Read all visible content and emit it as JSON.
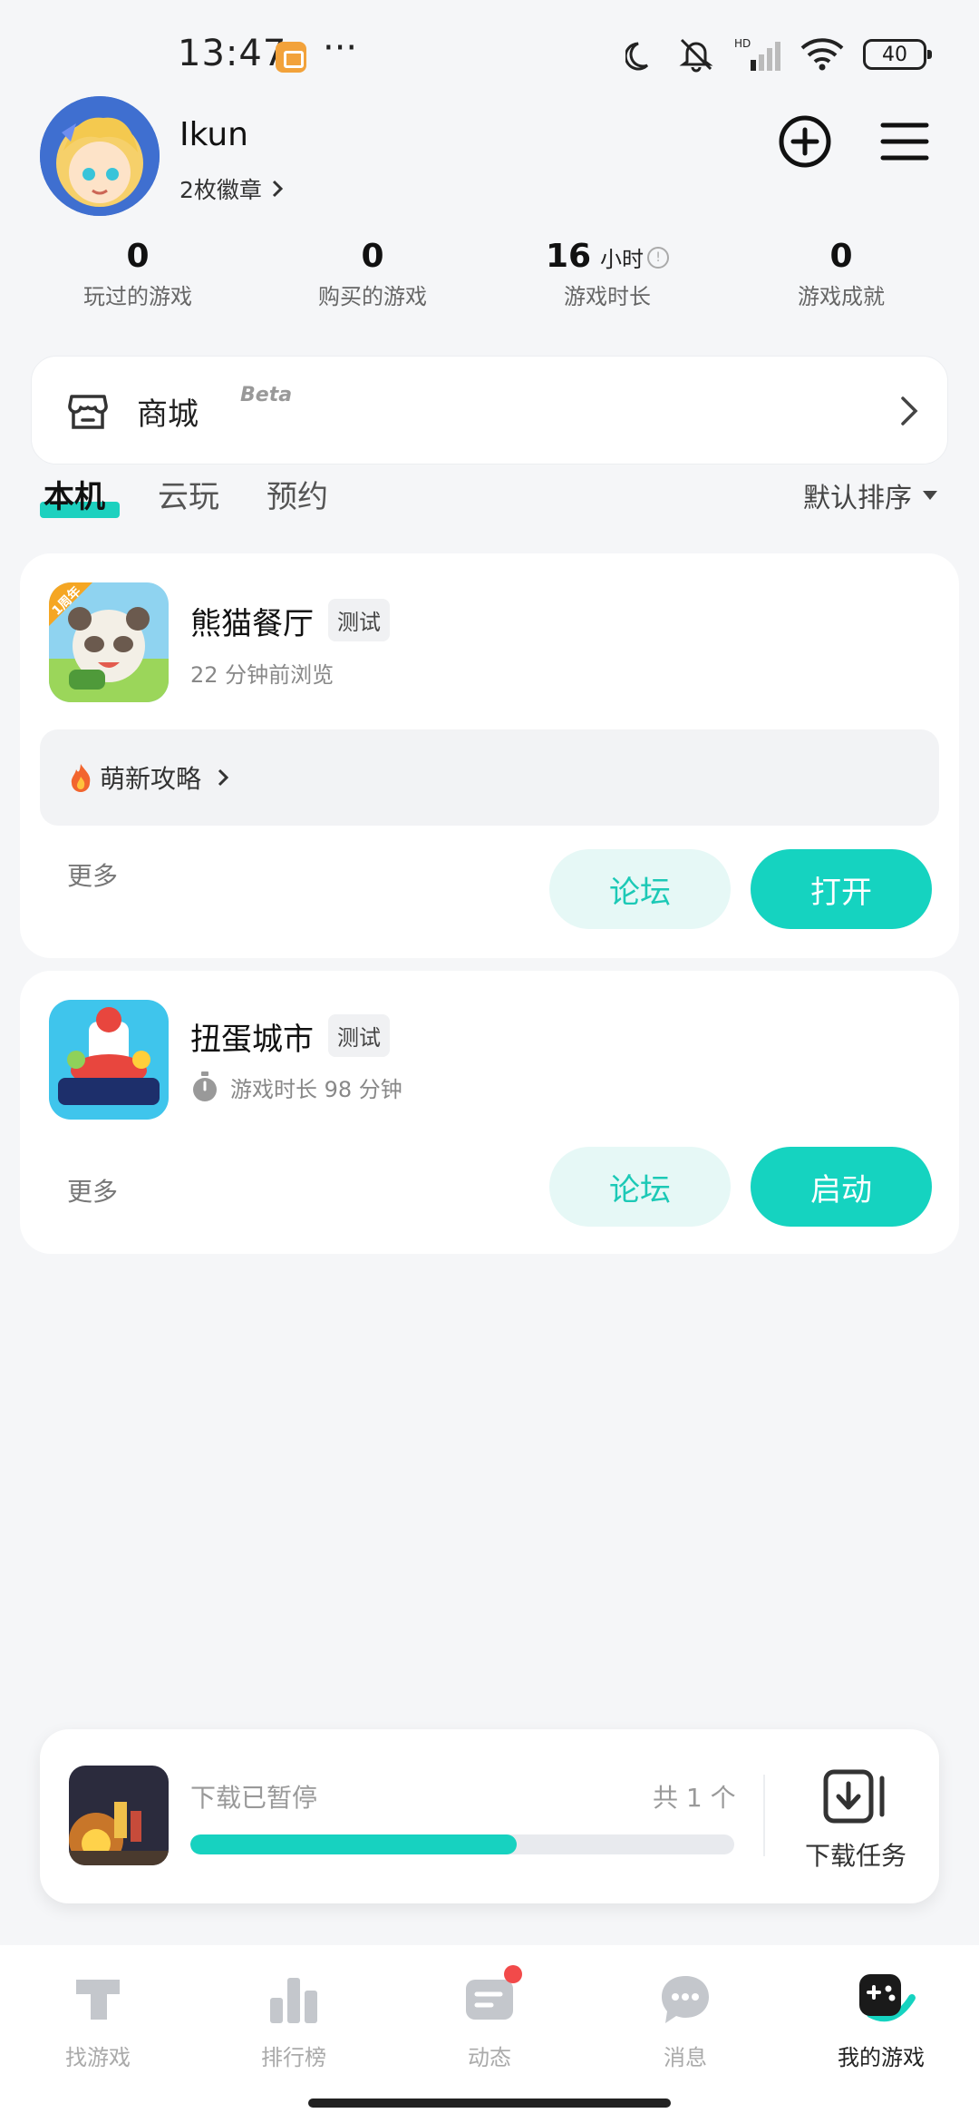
{
  "status_bar": {
    "time": "13:47",
    "dots": "···",
    "battery": "40",
    "icons": [
      "moon-icon",
      "mute-bell-icon",
      "signal-icon",
      "wifi-icon",
      "battery-icon"
    ]
  },
  "profile": {
    "username": "Ikun",
    "badges_label": "2枚徽章"
  },
  "stats": [
    {
      "value": "0",
      "unit": "",
      "label": "玩过的游戏"
    },
    {
      "value": "0",
      "unit": "",
      "label": "购买的游戏"
    },
    {
      "value": "16",
      "unit": "小时",
      "label": "游戏时长"
    },
    {
      "value": "0",
      "unit": "",
      "label": "游戏成就"
    }
  ],
  "store": {
    "label": "商城",
    "tag": "Beta"
  },
  "tabs": [
    {
      "label": "本机",
      "active": true
    },
    {
      "label": "云玩",
      "active": false
    },
    {
      "label": "预约",
      "active": false
    }
  ],
  "sort": {
    "label": "默认排序"
  },
  "games": [
    {
      "name": "熊猫餐厅",
      "tag": "测试",
      "subtitle": "22 分钟前浏览",
      "icon_corner": "1周年",
      "guide": "萌新攻略",
      "more": "更多",
      "forum": "论坛",
      "action": "打开"
    },
    {
      "name": "扭蛋城市",
      "tag": "测试",
      "subtitle": "游戏时长 98 分钟",
      "more": "更多",
      "forum": "论坛",
      "action": "启动"
    }
  ],
  "download": {
    "status": "下载已暂停",
    "count": "共 1 个",
    "progress": 0.6,
    "task_label": "下载任务"
  },
  "nav": [
    {
      "label": "找游戏",
      "icon": "find-game-icon",
      "active": false
    },
    {
      "label": "排行榜",
      "icon": "ranking-icon",
      "active": false
    },
    {
      "label": "动态",
      "icon": "feed-icon",
      "active": false,
      "dot": true
    },
    {
      "label": "消息",
      "icon": "message-icon",
      "active": false
    },
    {
      "label": "我的游戏",
      "icon": "my-games-icon",
      "active": true
    }
  ],
  "colors": {
    "accent": "#15d3c0",
    "accent_light": "#e6f8f6",
    "background": "#f5f6f8",
    "notification": "#f24a4a"
  }
}
